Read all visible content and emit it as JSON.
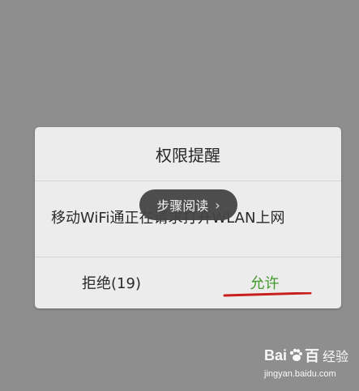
{
  "dialog": {
    "title": "权限提醒",
    "message": "移动WiFi通正在请求打开WLAN上网",
    "deny_button": "拒绝(19)",
    "allow_button": "允许"
  },
  "overlay": {
    "label": "步骤阅读",
    "chevron": "›"
  },
  "watermark": {
    "logo_text_left": "Bai",
    "logo_text_right": "百",
    "logo_text_jy": "经验",
    "url": "jingyan.baidu.com"
  },
  "colors": {
    "background": "#8e8e8e",
    "dialog_bg": "#ececec",
    "allow_green": "#3f9a2c",
    "underline_red": "#c81e1e"
  }
}
